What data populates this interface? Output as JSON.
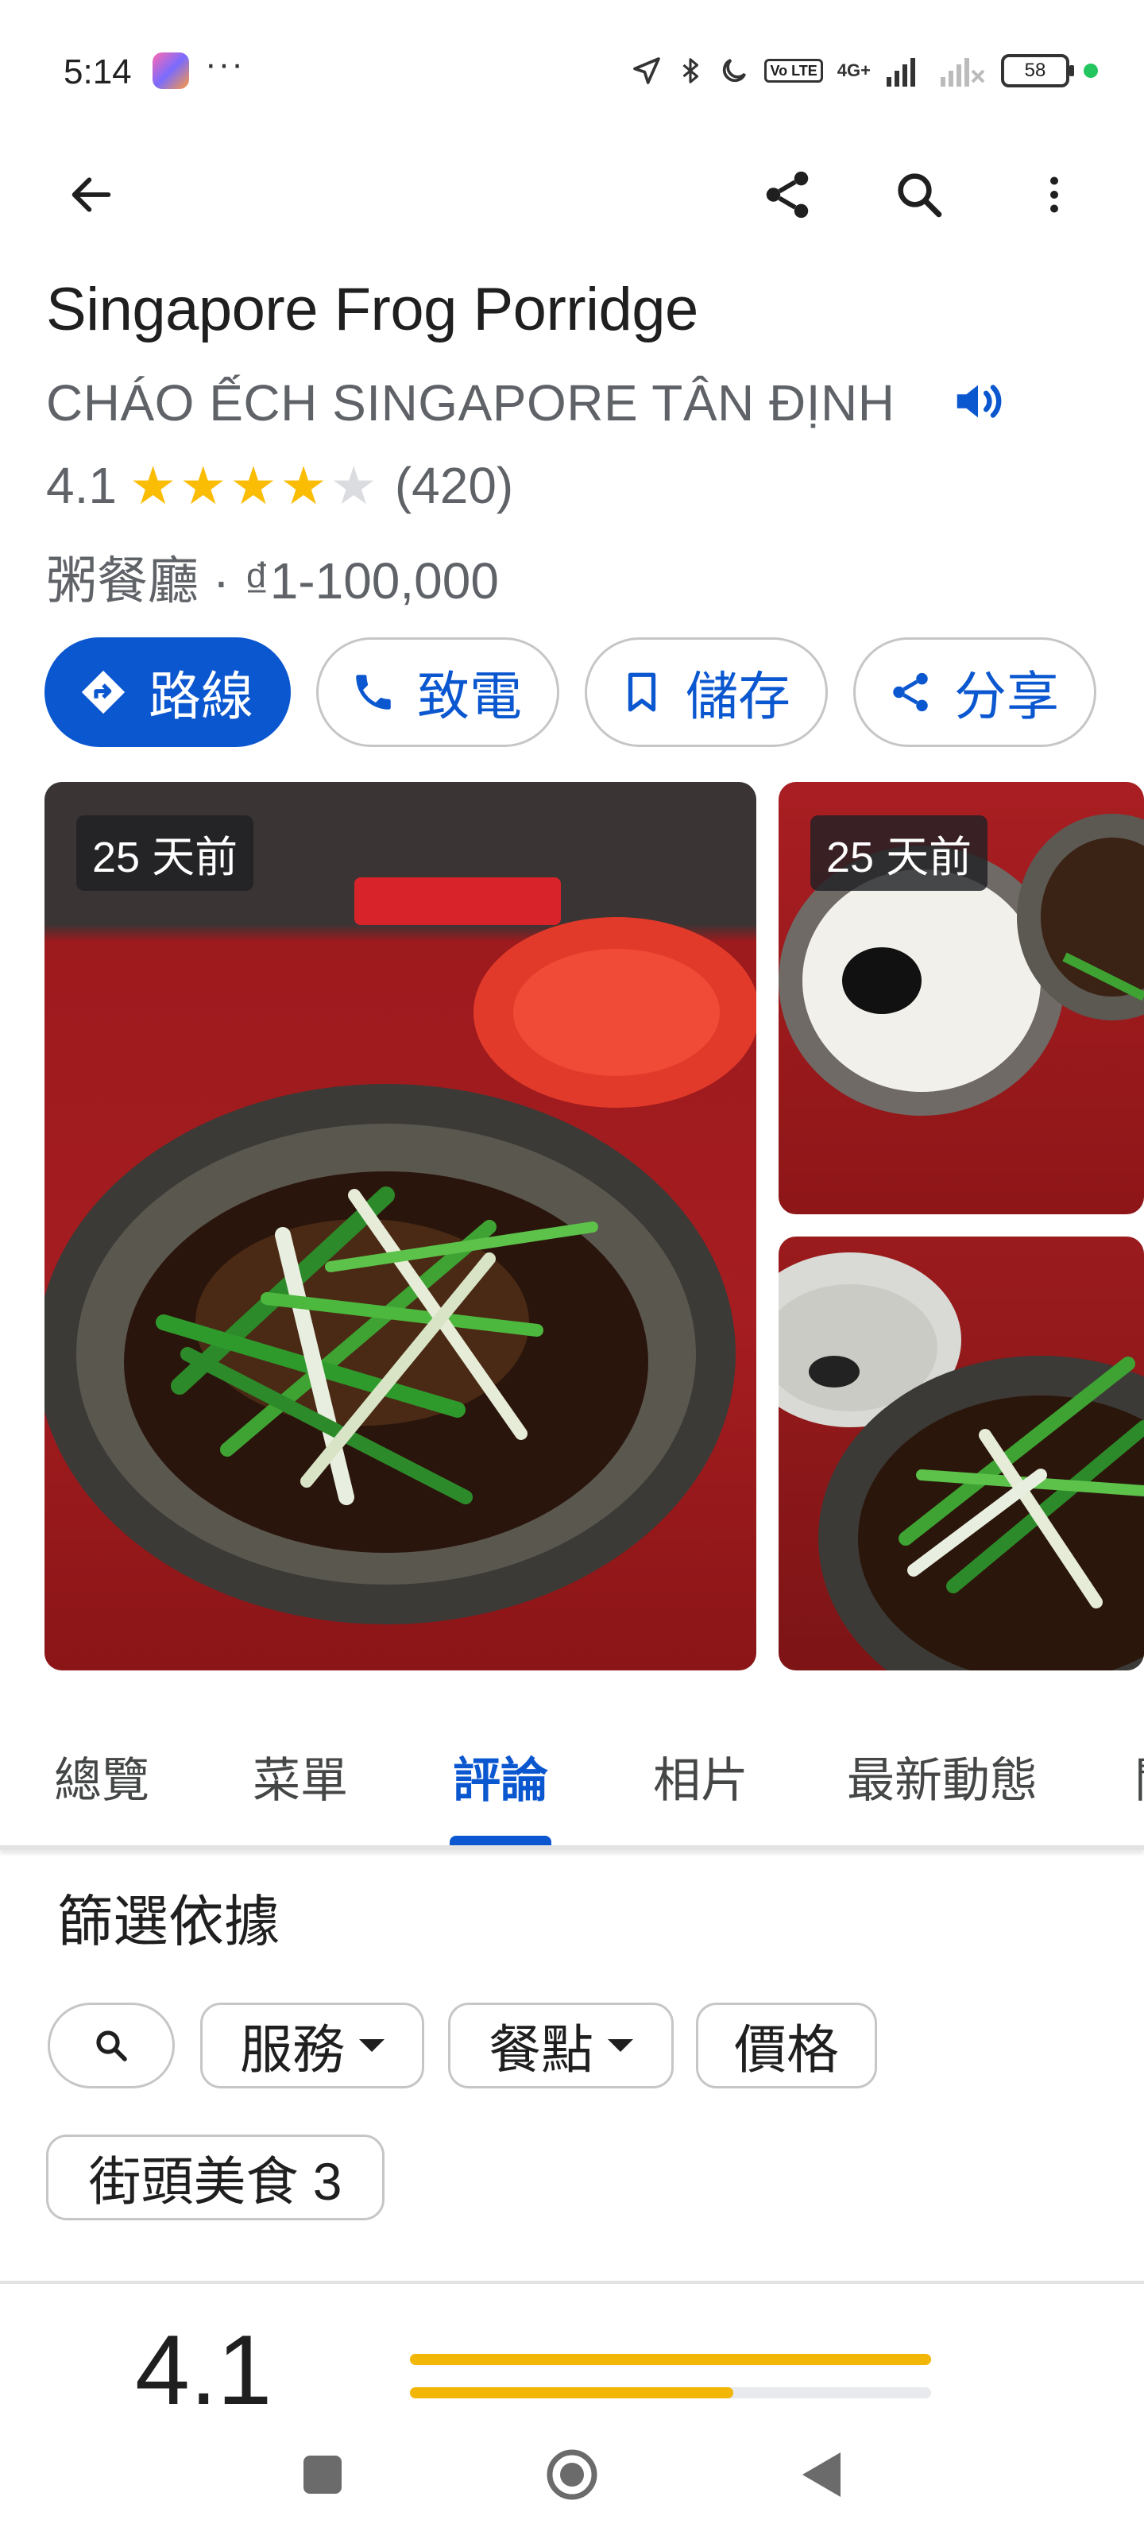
{
  "status_bar": {
    "time": "5:14",
    "dots": "···",
    "network_badge": "4G+",
    "lte_badge": "Vo LTE",
    "battery": "58"
  },
  "place": {
    "name": "Singapore Frog Porridge",
    "local_name": "CHÁO ẾCH SINGAPORE TÂN ĐỊNH",
    "rating": "4.1",
    "rating_stars": 4.1,
    "review_count": "(420)",
    "category_price": "粥餐廳 · ₫1-100,000"
  },
  "actions": [
    {
      "label": "路線",
      "icon": "directions-icon"
    },
    {
      "label": "致電",
      "icon": "phone-icon"
    },
    {
      "label": "儲存",
      "icon": "bookmark-icon"
    },
    {
      "label": "分享",
      "icon": "share-icon"
    }
  ],
  "photos": {
    "main_age": "25 天前",
    "second_age": "25 天前"
  },
  "tabs": [
    {
      "label": "總覽"
    },
    {
      "label": "菜單"
    },
    {
      "label": "評論",
      "active": true
    },
    {
      "label": "相片"
    },
    {
      "label": "最新動態"
    },
    {
      "label": "關"
    }
  ],
  "filter": {
    "title": "篩選依據",
    "chips": {
      "service": "服務",
      "food": "餐點",
      "price": "價格",
      "street_food": "街頭美食 3"
    }
  },
  "summary": {
    "score": "4.1",
    "bars": [
      1.0,
      0.62
    ]
  },
  "colors": {
    "accent": "#0b57d0",
    "star": "#fbbc04",
    "muted_text": "#5f6368"
  }
}
